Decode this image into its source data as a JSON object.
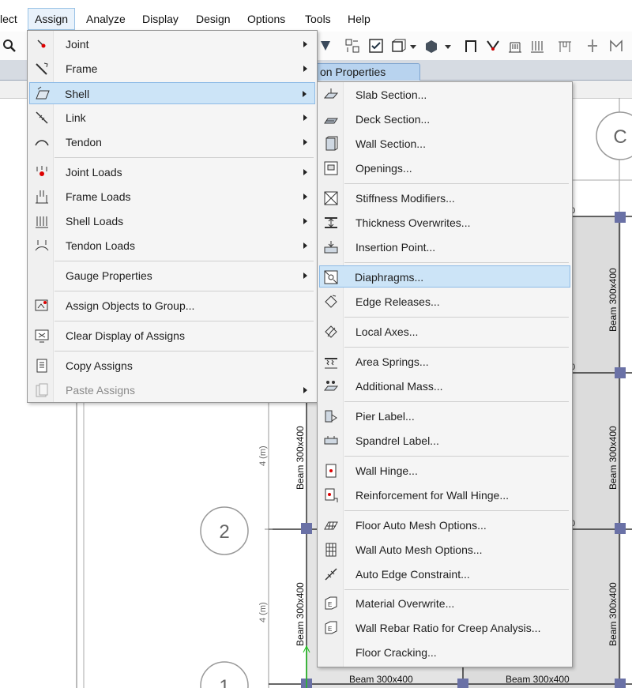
{
  "menubar": {
    "items": [
      {
        "label": "lect"
      },
      {
        "label": "Assign"
      },
      {
        "label": "Analyze"
      },
      {
        "label": "Display"
      },
      {
        "label": "Design"
      },
      {
        "label": "Options"
      },
      {
        "label": "Tools"
      },
      {
        "label": "Help"
      }
    ]
  },
  "tab": {
    "label": "on Properties"
  },
  "assign_menu": {
    "items": [
      {
        "label": "Joint",
        "icon": "joint-icon",
        "submenu": true
      },
      {
        "label": "Frame",
        "icon": "frame-icon",
        "submenu": true
      },
      {
        "label": "Shell",
        "icon": "shell-icon",
        "submenu": true,
        "highlighted": true
      },
      {
        "label": "Link",
        "icon": "link-icon",
        "submenu": true
      },
      {
        "label": "Tendon",
        "icon": "tendon-icon",
        "submenu": true
      },
      {
        "label": "Joint Loads",
        "icon": "joint-loads-icon",
        "submenu": true
      },
      {
        "label": "Frame Loads",
        "icon": "frame-loads-icon",
        "submenu": true
      },
      {
        "label": "Shell Loads",
        "icon": "shell-loads-icon",
        "submenu": true
      },
      {
        "label": "Tendon Loads",
        "icon": "tendon-loads-icon",
        "submenu": true
      },
      {
        "label": "Gauge Properties",
        "icon": "",
        "submenu": true
      },
      {
        "label": "Assign Objects to Group...",
        "icon": "group-icon",
        "submenu": false
      },
      {
        "label": "Clear Display of Assigns",
        "icon": "clear-display-icon",
        "submenu": false
      },
      {
        "label": "Copy Assigns",
        "icon": "copy-icon",
        "submenu": false
      },
      {
        "label": "Paste Assigns",
        "icon": "paste-icon",
        "submenu": true,
        "disabled": true
      }
    ]
  },
  "shell_submenu": {
    "items": [
      {
        "label": "Slab Section...",
        "icon": "slab-section-icon"
      },
      {
        "label": "Deck Section...",
        "icon": "deck-section-icon"
      },
      {
        "label": "Wall Section...",
        "icon": "wall-section-icon"
      },
      {
        "label": "Openings...",
        "icon": "openings-icon"
      },
      {
        "label": "Stiffness Modifiers...",
        "icon": "stiffness-modifiers-icon"
      },
      {
        "label": "Thickness Overwrites...",
        "icon": "thickness-overwrites-icon"
      },
      {
        "label": "Insertion Point...",
        "icon": "insertion-point-icon"
      },
      {
        "label": "Diaphragms...",
        "icon": "diaphragms-icon",
        "highlighted": true
      },
      {
        "label": "Edge Releases...",
        "icon": "edge-releases-icon"
      },
      {
        "label": "Local Axes...",
        "icon": "local-axes-icon"
      },
      {
        "label": "Area Springs...",
        "icon": "area-springs-icon"
      },
      {
        "label": "Additional Mass...",
        "icon": "additional-mass-icon"
      },
      {
        "label": "Pier Label...",
        "icon": "pier-label-icon"
      },
      {
        "label": "Spandrel Label...",
        "icon": "spandrel-label-icon"
      },
      {
        "label": "Wall Hinge...",
        "icon": "wall-hinge-icon"
      },
      {
        "label": "Reinforcement for Wall Hinge...",
        "icon": "reinforcement-wall-hinge-icon"
      },
      {
        "label": "Floor Auto Mesh Options...",
        "icon": "floor-auto-mesh-icon"
      },
      {
        "label": "Wall Auto Mesh Options...",
        "icon": "wall-auto-mesh-icon"
      },
      {
        "label": "Auto Edge Constraint...",
        "icon": "auto-edge-constraint-icon"
      },
      {
        "label": "Material Overwrite...",
        "icon": "material-overwrite-icon"
      },
      {
        "label": "Wall Rebar Ratio for Creep Analysis...",
        "icon": "wall-rebar-ratio-icon"
      },
      {
        "label": "Floor Cracking...",
        "icon": ""
      }
    ]
  },
  "drawing": {
    "grid_labels": [
      "C",
      "2",
      "1"
    ],
    "beam_label": "Beam 300x400",
    "dimension_label": "4 (m)",
    "edge_digit": "0"
  }
}
